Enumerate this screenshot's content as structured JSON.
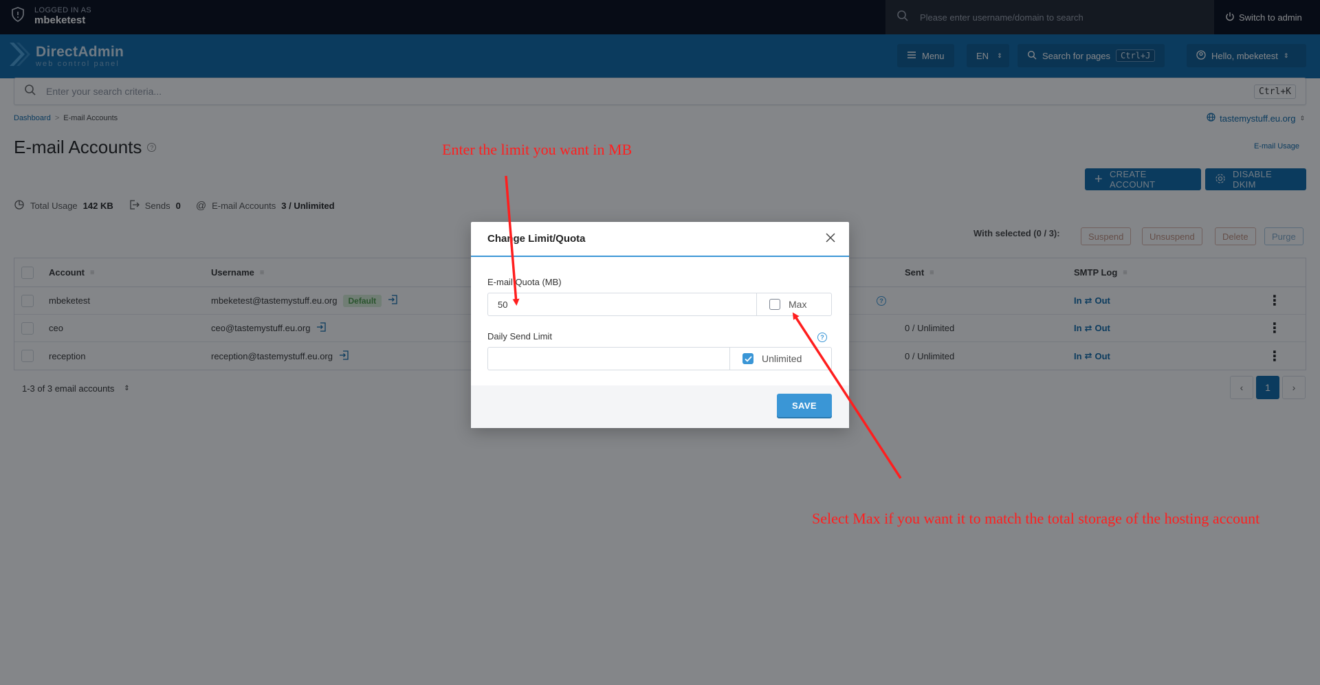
{
  "topbar": {
    "logged_label": "LOGGED IN AS",
    "username": "mbeketest",
    "search_placeholder": "Please enter username/domain to search",
    "switch_label": "Switch to admin"
  },
  "header": {
    "brand": "DirectAdmin",
    "brand_sub": "web control panel",
    "menu_label": "Menu",
    "lang_label": "EN",
    "page_search_label": "Search for pages",
    "page_search_shortcut": "Ctrl+J",
    "hello_label": "Hello, mbeketest"
  },
  "main_search": {
    "placeholder": "Enter your search criteria...",
    "shortcut": "Ctrl+K"
  },
  "breadcrumb": {
    "items": [
      "Dashboard",
      "E-mail Accounts"
    ],
    "separator": ">"
  },
  "domain_selector": "tastemystuff.eu.org",
  "page_title": "E-mail Accounts",
  "email_usage_link": "E-mail Usage",
  "actions": {
    "create": "CREATE ACCOUNT",
    "dkim": "DISABLE DKIM"
  },
  "stats": {
    "total_usage_label": "Total Usage",
    "total_usage_value": "142 KB",
    "sends_label": "Sends",
    "sends_value": "0",
    "accounts_label": "E-mail Accounts",
    "accounts_value": "3 / Unlimited"
  },
  "bulk": {
    "with_selected": "With selected (0 / 3):",
    "suspend": "Suspend",
    "unsuspend": "Unsuspend",
    "delete": "Delete",
    "purge": "Purge"
  },
  "table": {
    "columns": [
      "Account",
      "Username",
      "Sent",
      "SMTP Log"
    ],
    "rows": [
      {
        "account": "mbeketest",
        "username": "mbeketest@tastemystuff.eu.org",
        "badge": "Default",
        "sent": "",
        "smtp_in": "In",
        "smtp_sep": "⇄",
        "smtp_out": "Out"
      },
      {
        "account": "ceo",
        "username": "ceo@tastemystuff.eu.org",
        "badge": "",
        "sent": "0 / Unlimited",
        "smtp_in": "In",
        "smtp_sep": "⇄",
        "smtp_out": "Out"
      },
      {
        "account": "reception",
        "username": "reception@tastemystuff.eu.org",
        "badge": "",
        "sent": "0 / Unlimited",
        "smtp_in": "In",
        "smtp_sep": "⇄",
        "smtp_out": "Out"
      }
    ]
  },
  "footer_count": "1-3 of 3 email accounts",
  "pagination": {
    "current": "1",
    "prev": "‹",
    "next": "›"
  },
  "modal": {
    "title": "Change Limit/Quota",
    "quota_label": "E-mail Quota (MB)",
    "quota_value": "50",
    "max_label": "Max",
    "max_checked": false,
    "send_limit_label": "Daily Send Limit",
    "send_limit_value": "",
    "unlimited_label": "Unlimited",
    "unlimited_checked": true,
    "save_label": "SAVE"
  },
  "annotations": {
    "top": "Enter the limit you want in MB",
    "bottom": "Select Max if you want it to match the total storage of the hosting account",
    "color": "#ff1e1e"
  },
  "colors": {
    "topbar": "#050b19",
    "header": "#0d68a8",
    "accent": "#3a96d6"
  }
}
